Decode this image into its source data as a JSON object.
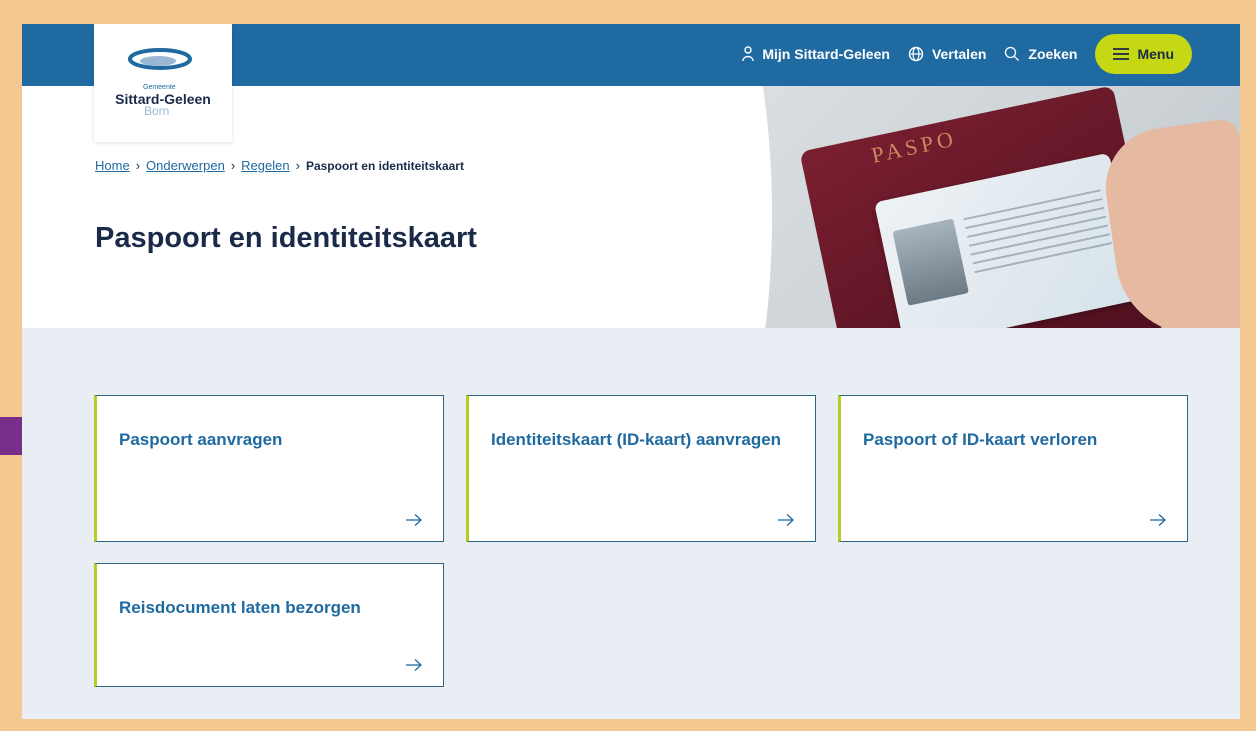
{
  "header": {
    "logo": {
      "small_text": "Gemeente",
      "name": "Sittard-Geleen",
      "subname": "Born"
    },
    "nav": {
      "account_label": "Mijn Sittard-Geleen",
      "translate_label": "Vertalen",
      "search_label": "Zoeken",
      "menu_label": "Menu"
    }
  },
  "breadcrumb": {
    "items": [
      "Home",
      "Onderwerpen",
      "Regelen"
    ],
    "current": "Paspoort en identiteitskaart"
  },
  "page": {
    "title": "Paspoort en identiteitskaart"
  },
  "hero_image": {
    "passport_text": "PASPO"
  },
  "cards": [
    {
      "title": "Paspoort aanvragen"
    },
    {
      "title": "Identiteitskaart (ID-kaart) aanvragen"
    },
    {
      "title": "Paspoort of ID-kaart verloren"
    },
    {
      "title": "Reisdocument laten bezorgen"
    }
  ],
  "colors": {
    "header_blue": "#1f6aa0",
    "menu_yellow": "#c5d813",
    "frame_orange": "#f3c891",
    "pointer_purple": "#7a2e8c"
  }
}
